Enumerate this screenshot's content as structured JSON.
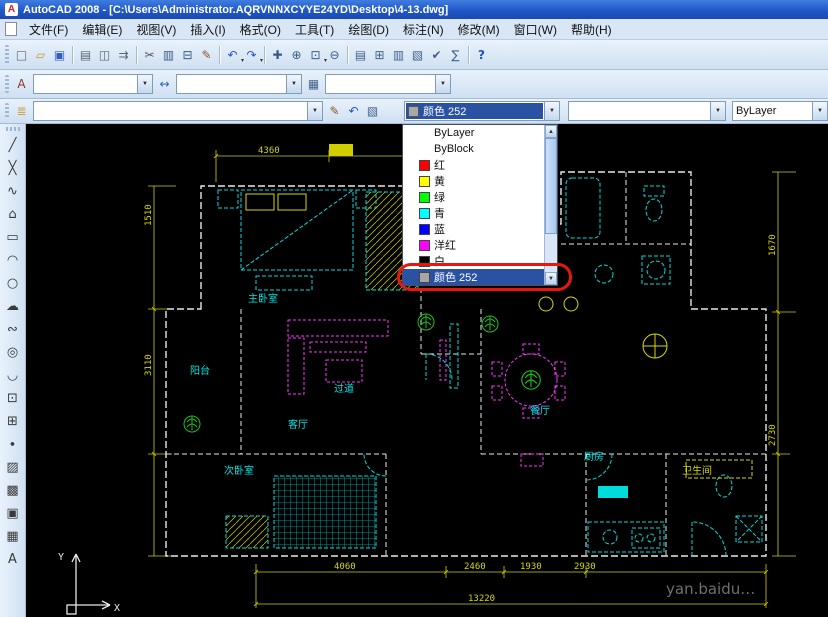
{
  "window": {
    "title": "AutoCAD 2008 - [C:\\Users\\Administrator.AQRVNNXCYYE24YD\\Desktop\\4-13.dwg]",
    "app_icon_glyph": "A"
  },
  "menu_bar": {
    "items": [
      {
        "name": "file",
        "label": "文件(F)"
      },
      {
        "name": "edit",
        "label": "编辑(E)"
      },
      {
        "name": "view",
        "label": "视图(V)"
      },
      {
        "name": "insert",
        "label": "插入(I)"
      },
      {
        "name": "format",
        "label": "格式(O)"
      },
      {
        "name": "tools",
        "label": "工具(T)"
      },
      {
        "name": "draw",
        "label": "绘图(D)"
      },
      {
        "name": "dimension",
        "label": "标注(N)"
      },
      {
        "name": "modify",
        "label": "修改(M)"
      },
      {
        "name": "window",
        "label": "窗口(W)"
      },
      {
        "name": "help",
        "label": "帮助(H)"
      }
    ]
  },
  "standard_toolbar": {
    "buttons": [
      {
        "name": "qnew",
        "glyph": "□",
        "color": "#666666"
      },
      {
        "name": "open",
        "glyph": "▱",
        "color": "#c9972f"
      },
      {
        "name": "save",
        "glyph": "▣",
        "color": "#2f5fc0"
      },
      {
        "sep": true
      },
      {
        "name": "plot",
        "glyph": "▤",
        "color": "#5a6675"
      },
      {
        "name": "plot-preview",
        "glyph": "◫",
        "color": "#5a6675"
      },
      {
        "name": "publish",
        "glyph": "⇉",
        "color": "#5a6675"
      },
      {
        "sep": true
      },
      {
        "name": "cut",
        "glyph": "✂",
        "color": "#555555"
      },
      {
        "name": "copy",
        "glyph": "▥",
        "color": "#3c5a86"
      },
      {
        "name": "paste",
        "glyph": "⊟",
        "color": "#3c5a86"
      },
      {
        "name": "match-properties",
        "glyph": "✎",
        "color": "#8a5a2a"
      },
      {
        "sep": true
      },
      {
        "name": "undo",
        "glyph": "↶",
        "color": "#2356c4",
        "arrow": true
      },
      {
        "name": "redo",
        "glyph": "↷",
        "color": "#2356c4",
        "arrow": true
      },
      {
        "sep": true
      },
      {
        "name": "pan",
        "glyph": "✚",
        "color": "#3c5a86"
      },
      {
        "name": "zoom-realtime",
        "glyph": "⊕",
        "color": "#3c5a86"
      },
      {
        "name": "zoom-window",
        "glyph": "⊡",
        "color": "#3c5a86",
        "arrow": true
      },
      {
        "name": "zoom-previous",
        "glyph": "⊖",
        "color": "#3c5a86"
      },
      {
        "sep": true
      },
      {
        "name": "properties",
        "glyph": "▤",
        "color": "#44618a"
      },
      {
        "name": "designcenter",
        "glyph": "⊞",
        "color": "#44618a"
      },
      {
        "name": "tool-palettes",
        "glyph": "▥",
        "color": "#44618a"
      },
      {
        "name": "sheet-set-manager",
        "glyph": "▧",
        "color": "#44618a"
      },
      {
        "name": "markup",
        "glyph": "✔",
        "color": "#44618a"
      },
      {
        "name": "quickcalc",
        "glyph": "∑",
        "color": "#44618a"
      },
      {
        "sep": true
      },
      {
        "name": "help",
        "glyph": "?",
        "color": "#1a4fd0",
        "bold": true
      }
    ]
  },
  "styles_toolbar": {
    "text_style_icon": "A",
    "text_style_value": "",
    "dim_style_icon": "↔",
    "dim_style_value": "",
    "table_style_icon": "▦",
    "table_style_value": ""
  },
  "layers_toolbar": {
    "manager_icon": "≣",
    "layer_value": "",
    "make_current_icon": "✎",
    "previous_icon": "↶",
    "states_icon": "▧"
  },
  "properties_toolbar": {
    "color_field": {
      "value": "颜色 252",
      "swatch": "#a8a8a8"
    },
    "linetype_field": {
      "value": ""
    },
    "lineweight_field": {
      "value": "ByLayer"
    }
  },
  "color_dropdown": {
    "items": [
      {
        "name": "bylayer",
        "label": "ByLayer",
        "swatch": null,
        "selected": false
      },
      {
        "name": "byblock",
        "label": "ByBlock",
        "swatch": null,
        "selected": false
      },
      {
        "name": "red",
        "label": "红",
        "swatch": "#ff0000",
        "selected": false
      },
      {
        "name": "yellow",
        "label": "黄",
        "swatch": "#ffff00",
        "selected": false
      },
      {
        "name": "green",
        "label": "绿",
        "swatch": "#00ff00",
        "selected": false
      },
      {
        "name": "cyan",
        "label": "青",
        "swatch": "#00ffff",
        "selected": false
      },
      {
        "name": "blue",
        "label": "蓝",
        "swatch": "#0000ff",
        "selected": false
      },
      {
        "name": "magenta",
        "label": "洋红",
        "swatch": "#ff00ff",
        "selected": false
      },
      {
        "name": "white",
        "label": "白",
        "swatch": "#000000",
        "selected": false
      },
      {
        "name": "color-252",
        "label": "颜色 252",
        "swatch": "#a6a6a6",
        "selected": true
      }
    ]
  },
  "draw_toolbar": {
    "buttons": [
      {
        "name": "line",
        "glyph": "╱"
      },
      {
        "name": "construction-line",
        "glyph": "╳"
      },
      {
        "name": "polyline",
        "glyph": "∿"
      },
      {
        "name": "polygon",
        "glyph": "⌂"
      },
      {
        "name": "rectangle",
        "glyph": "▭"
      },
      {
        "name": "arc",
        "glyph": "◠"
      },
      {
        "name": "circle",
        "glyph": "○"
      },
      {
        "name": "revision-cloud",
        "glyph": "☁"
      },
      {
        "name": "spline",
        "glyph": "∾"
      },
      {
        "name": "ellipse",
        "glyph": "◎"
      },
      {
        "name": "ellipse-arc",
        "glyph": "◡"
      },
      {
        "name": "insert-block",
        "glyph": "⊡"
      },
      {
        "name": "make-block",
        "glyph": "⊞"
      },
      {
        "name": "point",
        "glyph": "∙"
      },
      {
        "name": "hatch",
        "glyph": "▨"
      },
      {
        "name": "gradient",
        "glyph": "▩"
      },
      {
        "name": "region",
        "glyph": "▣"
      },
      {
        "name": "table",
        "glyph": "▦"
      },
      {
        "name": "multiline-text",
        "glyph": "A"
      }
    ]
  },
  "canvas": {
    "rooms": [
      {
        "name": "master-bedroom",
        "label": "主卧室"
      },
      {
        "name": "balcony",
        "label": "阳台"
      },
      {
        "name": "living-room",
        "label": "客厅"
      },
      {
        "name": "corridor",
        "label": "过道"
      },
      {
        "name": "second-bedroom",
        "label": "次卧室"
      },
      {
        "name": "dining-room",
        "label": "餐厅"
      },
      {
        "name": "kitchen",
        "label": "厨房"
      },
      {
        "name": "bathroom",
        "label": "卫生间"
      }
    ],
    "dimensions": {
      "top": [
        "4360"
      ],
      "bottom": [
        "4060",
        "2460",
        "1930",
        "2930"
      ],
      "total": "13220",
      "left": [
        "1510",
        "3110"
      ],
      "right": [
        "1670",
        "2730"
      ]
    },
    "watermark": "yan.baidu…",
    "ucs": {
      "x": "X",
      "y": "Y"
    }
  }
}
